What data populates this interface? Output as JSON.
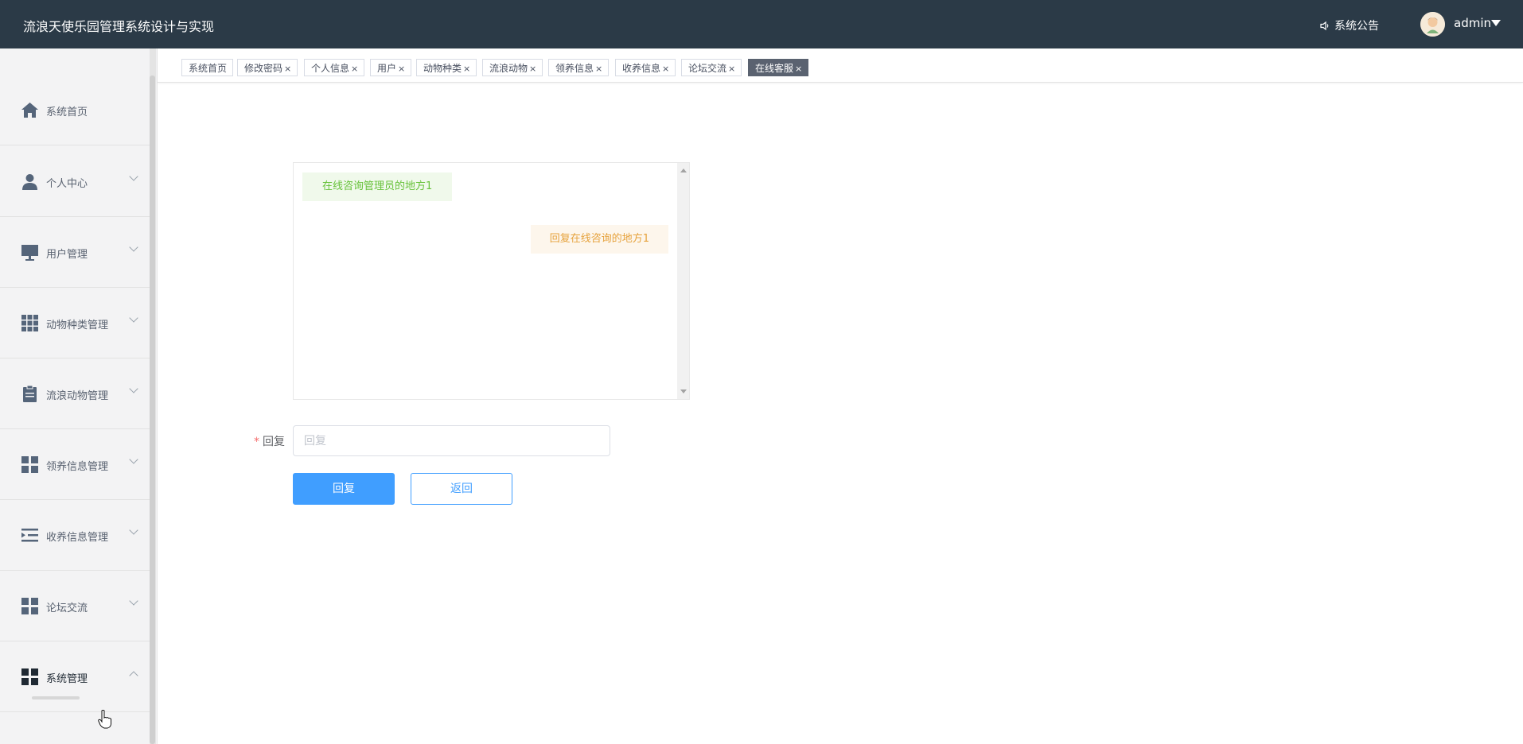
{
  "header": {
    "title": "流浪天使乐园管理系统设计与实现",
    "notice_label": "系统公告",
    "username": "admin"
  },
  "sidebar": {
    "items": [
      {
        "label": "系统首页",
        "icon": "home-icon"
      },
      {
        "label": "个人中心",
        "icon": "user-icon"
      },
      {
        "label": "用户管理",
        "icon": "monitor-icon"
      },
      {
        "label": "动物种类管理",
        "icon": "grid-icon"
      },
      {
        "label": "流浪动物管理",
        "icon": "clipboard-icon"
      },
      {
        "label": "领养信息管理",
        "icon": "dashboard-icon"
      },
      {
        "label": "收养信息管理",
        "icon": "list-indent-icon"
      },
      {
        "label": "论坛交流",
        "icon": "dashboard-icon"
      },
      {
        "label": "系统管理",
        "icon": "apps-icon"
      }
    ]
  },
  "tabs": [
    {
      "label": "系统首页",
      "closable": false
    },
    {
      "label": "修改密码",
      "closable": true
    },
    {
      "label": "个人信息",
      "closable": true
    },
    {
      "label": "用户",
      "closable": true
    },
    {
      "label": "动物种类",
      "closable": true
    },
    {
      "label": "流浪动物",
      "closable": true
    },
    {
      "label": "领养信息",
      "closable": true
    },
    {
      "label": "收养信息",
      "closable": true
    },
    {
      "label": "论坛交流",
      "closable": true
    },
    {
      "label": "在线客服",
      "closable": true,
      "active": true
    }
  ],
  "tab_close_glyph": "×",
  "chat": {
    "messages": [
      {
        "side": "left",
        "text": "在线咨询管理员的地方1"
      },
      {
        "side": "right",
        "text": "回复在线咨询的地方1"
      }
    ]
  },
  "form": {
    "reply_label": "回复",
    "required_mark": "*",
    "reply_placeholder": "回复",
    "reply_value": "",
    "submit_label": "回复",
    "back_label": "返回"
  },
  "colors": {
    "header_bg": "#2b3a47",
    "primary": "#409eff",
    "success_text": "#67c23a",
    "warning_text": "#e6a23c",
    "active_tab_bg": "#5a6270"
  }
}
